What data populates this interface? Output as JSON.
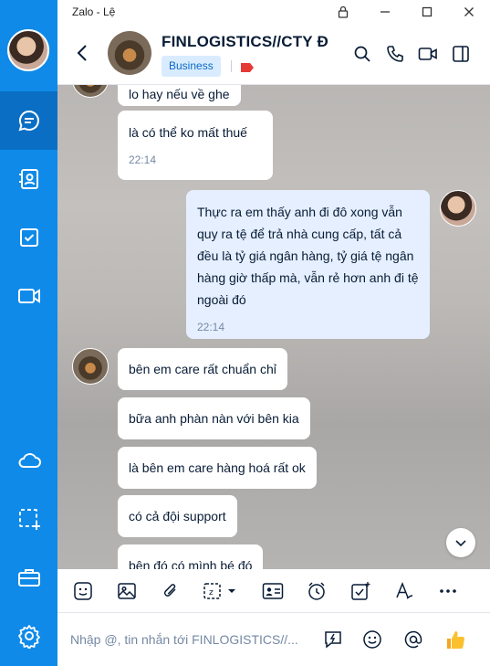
{
  "window": {
    "title": "Zalo - Lệ"
  },
  "header": {
    "group_name": "FINLOGISTICS//CTY Đ",
    "badge": "Business"
  },
  "messages": [
    {
      "sender": "other",
      "text": "lo hay nếu về ghe"
    },
    {
      "sender": "other",
      "text": "là có thể ko mất thuế",
      "time": "22:14"
    },
    {
      "sender": "me",
      "text": "Thực ra em thấy anh đi đô xong vẫn quy ra tệ để trả nhà cung cấp, tất cả đều là tỷ giá ngân hàng, tỷ giá tệ ngân hàng giờ thấp mà, vẫn rẻ hơn anh đi tệ ngoài đó",
      "time": "22:14"
    },
    {
      "sender": "other",
      "text": "bên em care rất chuẩn chỉ"
    },
    {
      "sender": "other",
      "text": "bữa anh phàn nàn với bên kia"
    },
    {
      "sender": "other",
      "text": "là bên em care hàng hoá rất ok"
    },
    {
      "sender": "other",
      "text": "có cả đội support"
    },
    {
      "sender": "other",
      "text": "bên đó có mình bé đó"
    }
  ],
  "composer": {
    "placeholder": "Nhập @, tin nhắn tới FINLOGISTICS//..."
  },
  "colors": {
    "nav": "#0f8ae8",
    "accent": "#0a68c6",
    "my_bubble": "#e5efff"
  },
  "icons": {
    "nav": [
      "chat-icon",
      "contacts-icon",
      "todo-icon",
      "video-icon",
      "cloud-icon",
      "screenshot-icon",
      "toolbox-icon",
      "settings-icon"
    ],
    "header": [
      "search-icon",
      "phone-icon",
      "video-call-icon",
      "sidebar-toggle-icon"
    ],
    "toolbar": [
      "sticker-icon",
      "image-icon",
      "attachment-icon",
      "screenshot-icon",
      "contact-card-icon",
      "reminder-icon",
      "task-icon",
      "format-icon",
      "more-icon"
    ],
    "composer": [
      "quick-message-icon",
      "emoji-icon",
      "mention-icon",
      "like-icon"
    ]
  }
}
